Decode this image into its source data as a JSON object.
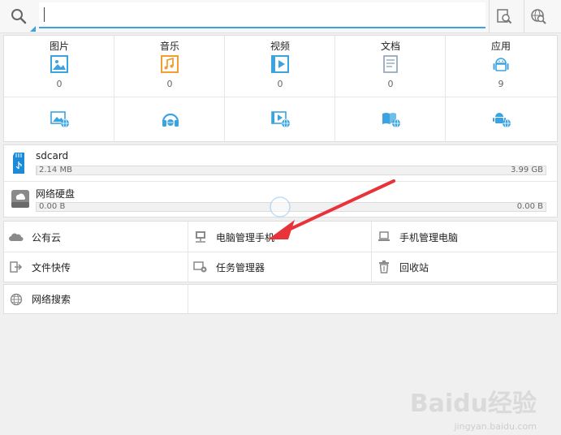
{
  "search": {
    "value": "",
    "placeholder": ""
  },
  "toolbar": {
    "file_search_icon": "file-search-icon",
    "web_search_icon": "web-search-icon"
  },
  "categories": [
    {
      "label": "图片",
      "count": "0",
      "icon": "picture-icon"
    },
    {
      "label": "音乐",
      "count": "0",
      "icon": "music-icon"
    },
    {
      "label": "视频",
      "count": "0",
      "icon": "video-icon"
    },
    {
      "label": "文档",
      "count": "0",
      "icon": "document-icon"
    },
    {
      "label": "应用",
      "count": "9",
      "icon": "android-icon"
    }
  ],
  "network_categories": [
    {
      "icon": "network-picture-icon"
    },
    {
      "icon": "network-music-icon"
    },
    {
      "icon": "network-video-icon"
    },
    {
      "icon": "network-book-icon"
    },
    {
      "icon": "network-app-icon"
    }
  ],
  "storage": [
    {
      "name": "sdcard",
      "used": "2.14 MB",
      "total": "3.99 GB",
      "fill_fraction": 0.001
    },
    {
      "name": "网络硬盘",
      "used": "0.00 B",
      "total": "0.00 B",
      "fill_fraction": 0.0
    }
  ],
  "menu": {
    "public_cloud": "公有云",
    "pc_manage_phone": "电脑管理手机",
    "phone_manage_pc": "手机管理电脑",
    "file_transfer": "文件快传",
    "task_manager": "任务管理器",
    "recycle_bin": "回收站",
    "network_search": "网络搜索"
  },
  "watermark": {
    "brand": "Baidu经验",
    "url": "jingyan.baidu.com"
  },
  "colors": {
    "accent": "#3ba4e0",
    "arrow": "#e8333a"
  }
}
